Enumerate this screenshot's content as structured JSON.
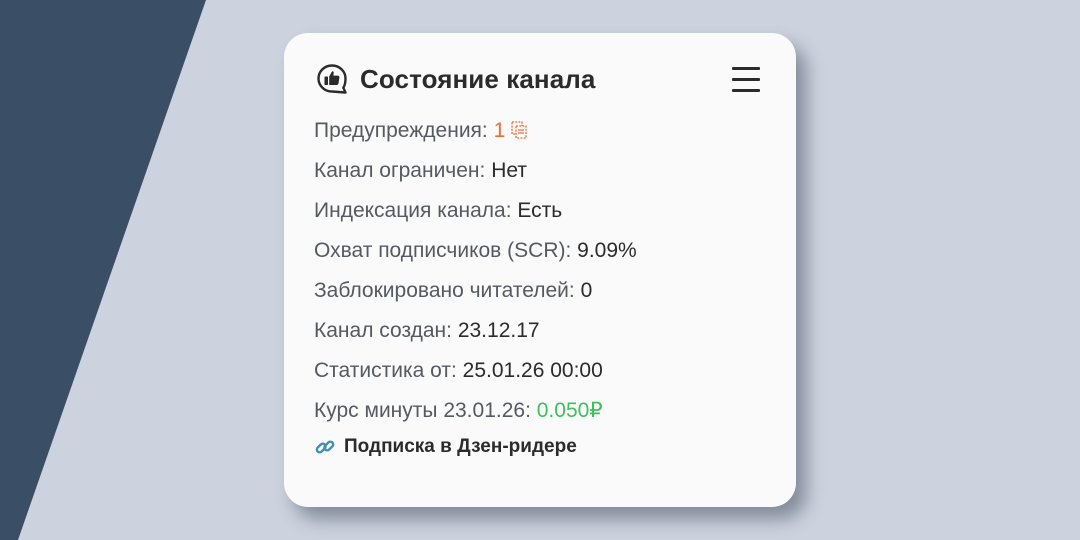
{
  "colors": {
    "page_bg": "#cdd3de",
    "stripe": "#3a4f66",
    "card_bg": "#fafafa",
    "warning": "#f06a35",
    "positive": "#3fbf5e"
  },
  "card": {
    "icon": "thumbs-up-bubble-icon",
    "title": "Состояние канала",
    "menu_icon": "hamburger-menu-icon"
  },
  "rows": {
    "warnings": {
      "label": "Предупреждения: ",
      "value": "1",
      "icon": "copy-icon"
    },
    "restricted": {
      "label": "Канал ограничен: ",
      "value": "Нет"
    },
    "indexing": {
      "label": "Индексация канала: ",
      "value": "Есть"
    },
    "scr": {
      "label": "Охват подписчиков (SCR): ",
      "value": "9.09%"
    },
    "blocked": {
      "label": "Заблокировано читателей: ",
      "value": "0"
    },
    "created": {
      "label": "Канал создан: ",
      "value": "23.12.17"
    },
    "stats": {
      "label": "Статистика от: ",
      "value": "25.01.26 00:00"
    },
    "rate": {
      "label": "Курс минуты 23.01.26: ",
      "value": "0.050₽"
    }
  },
  "link": {
    "icon": "link-icon",
    "label": "Подписка в Дзен-ридере"
  }
}
